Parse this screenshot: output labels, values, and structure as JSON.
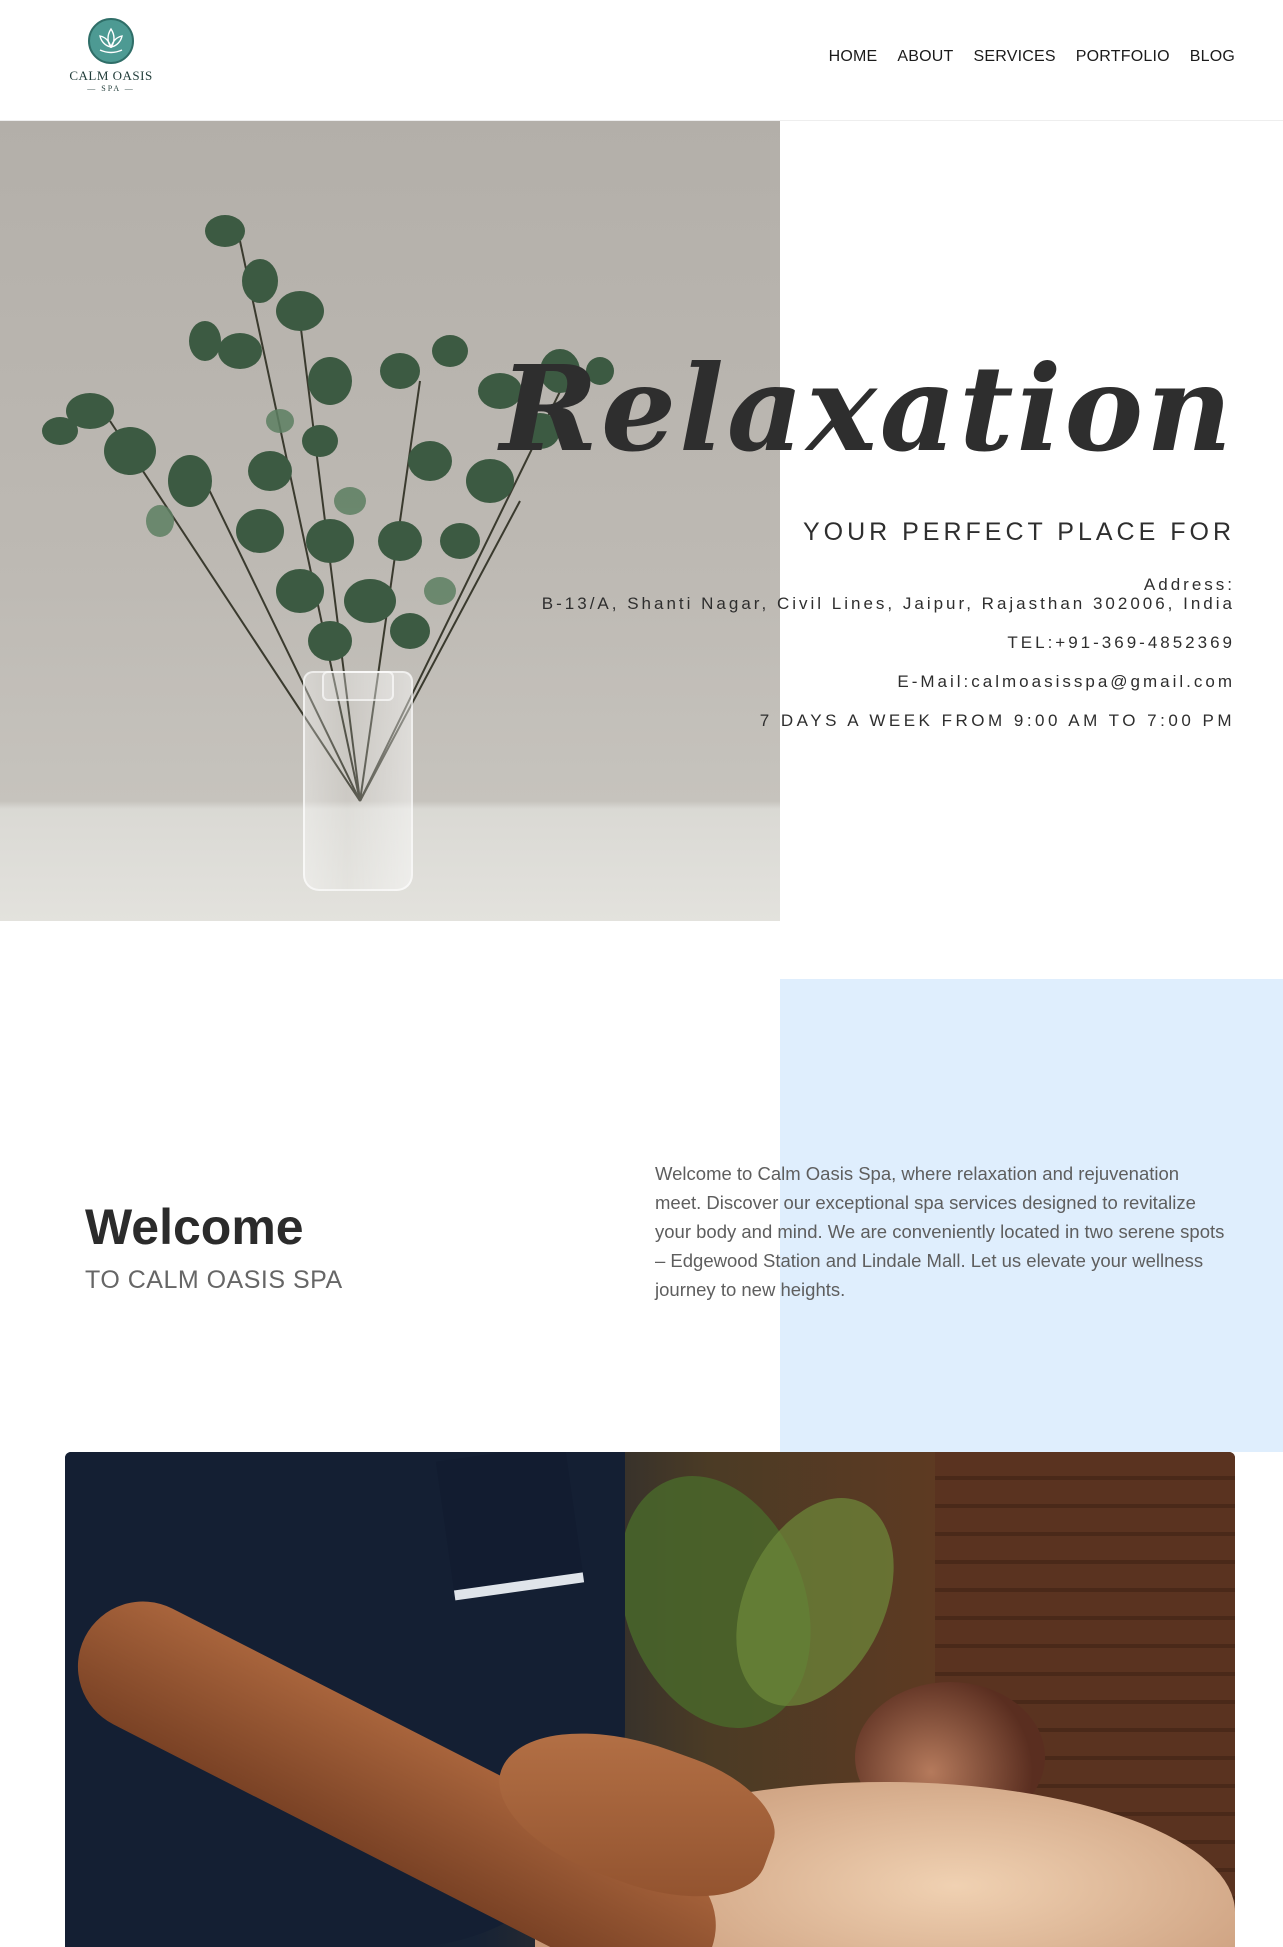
{
  "brand": {
    "name": "CALM OASIS",
    "sub": "SPA"
  },
  "nav": {
    "items": [
      {
        "label": "HOME"
      },
      {
        "label": "ABOUT"
      },
      {
        "label": "SERVICES"
      },
      {
        "label": "PORTFOLIO"
      },
      {
        "label": "BLOG"
      }
    ]
  },
  "hero": {
    "title": "Relaxation",
    "subtitle": "YOUR PERFECT PLACE FOR",
    "address_label": "Address:",
    "address_value": "B-13/A, Shanti Nagar, Civil Lines, Jaipur, Rajasthan 302006, India",
    "tel": "TEL:+91-369-4852369",
    "email": "E-Mail:calmoasisspa@gmail.com",
    "hours": "7 DAYS A WEEK FROM 9:00 AM TO 7:00 PM"
  },
  "welcome": {
    "title": "Welcome",
    "subtitle": "TO CALM OASIS SPA",
    "body": "Welcome to Calm Oasis Spa, where relaxation and rejuvenation meet. Discover our exceptional spa services designed to revitalize your body and mind. We are conveniently located in two serene spots – Edgewood Station and Lindale Mall. Let us elevate your wellness journey to new heights."
  },
  "colors": {
    "accent_panel": "#dfeefd",
    "logo_teal": "#4d9a93",
    "text_dark": "#2e2e2e"
  },
  "icons": {
    "logo": "lotus-icon"
  }
}
